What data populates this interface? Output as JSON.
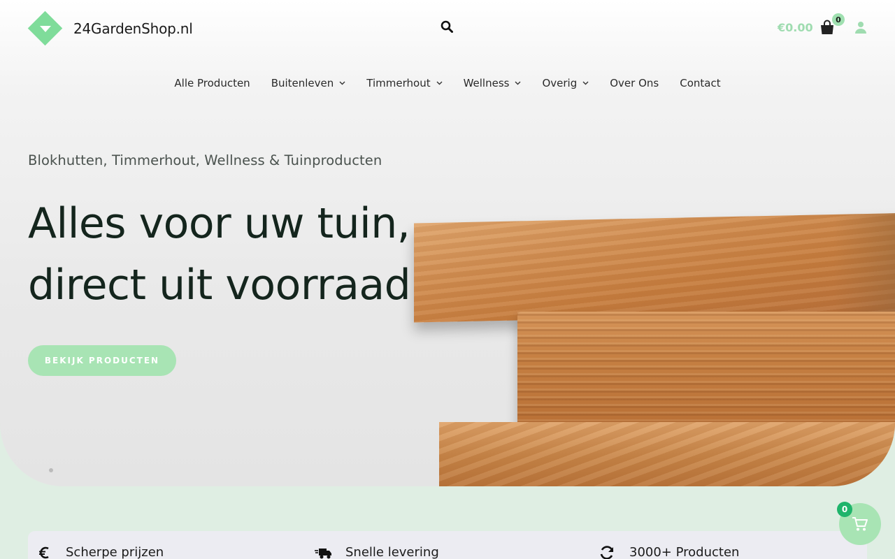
{
  "header": {
    "logo_text": "24GardenShop.nl",
    "cart_total": "€0.00",
    "cart_count": "0"
  },
  "nav": {
    "items": [
      {
        "label": "Alle Producten",
        "dropdown": false
      },
      {
        "label": "Buitenleven",
        "dropdown": true
      },
      {
        "label": "Timmerhout",
        "dropdown": true
      },
      {
        "label": "Wellness",
        "dropdown": true
      },
      {
        "label": "Overig",
        "dropdown": true
      },
      {
        "label": "Over Ons",
        "dropdown": false
      },
      {
        "label": "Contact",
        "dropdown": false
      }
    ]
  },
  "hero": {
    "subtitle": "Blokhutten, Timmerhout, Wellness & Tuinproducten",
    "headline_line1": "Alles voor uw tuin,",
    "headline_line2": "direct uit voorraad",
    "cta_label": "BEKIJK PRODUCTEN"
  },
  "features": [
    {
      "label": "Scherpe prijzen",
      "icon": "euro-icon"
    },
    {
      "label": "Snelle levering",
      "icon": "truck-icon"
    },
    {
      "label": "3000+ Producten",
      "icon": "refresh-icon"
    }
  ],
  "floating_cart": {
    "count": "0"
  },
  "colors": {
    "brand_green": "#7fdc9a",
    "button_green": "#a8e4b4",
    "badge_green": "#1fb46b",
    "section_bg": "#dfeee3"
  }
}
